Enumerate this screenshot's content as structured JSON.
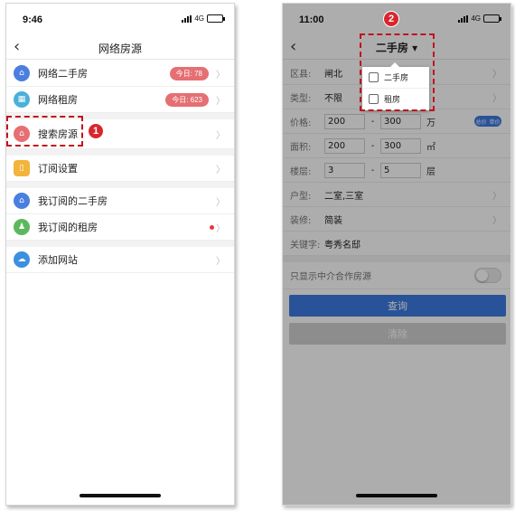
{
  "left": {
    "status": {
      "time": "9:46",
      "network": "4G"
    },
    "nav": {
      "back": "‹",
      "title": "网络房源"
    },
    "items": [
      {
        "label": "网络二手房",
        "badge": "今日: 78",
        "color": "#4a7fe0",
        "icon": "home-icon"
      },
      {
        "label": "网络租房",
        "badge": "今日: 623",
        "color": "#4ab0d8",
        "icon": "rent-icon"
      },
      {
        "label": "搜索房源",
        "color": "#e56f73",
        "icon": "search-house-icon"
      },
      {
        "label": "订阅设置",
        "color": "#f2b43a",
        "icon": "subscribe-icon"
      },
      {
        "label": "我订阅的二手房",
        "color": "#4a7fe0",
        "icon": "house-icon"
      },
      {
        "label": "我订阅的租房",
        "color": "#5cb85c",
        "icon": "user-icon"
      },
      {
        "label": "添加网站",
        "color": "#3d8fe0",
        "icon": "cloud-icon"
      }
    ],
    "callout": "1"
  },
  "right": {
    "status": {
      "time": "11:00",
      "network": "4G"
    },
    "nav": {
      "back": "‹",
      "title": "二手房 ▾"
    },
    "dropdown": [
      "二手房",
      "租房"
    ],
    "callout": "2",
    "form": {
      "district": {
        "label": "区县:",
        "value": "闸北"
      },
      "type": {
        "label": "类型:",
        "value": "不限"
      },
      "price": {
        "label": "价格:",
        "min": "200",
        "max": "300",
        "unit": "万",
        "toggle_a": "总价",
        "toggle_b": "单价"
      },
      "area": {
        "label": "面积:",
        "min": "200",
        "max": "300",
        "unit": "㎡"
      },
      "floor": {
        "label": "楼层:",
        "min": "3",
        "max": "5",
        "unit": "层"
      },
      "layout": {
        "label": "户型:",
        "value": "二室,三室"
      },
      "decoration": {
        "label": "装修:",
        "value": "简装"
      },
      "keyword": {
        "label": "关键字:",
        "value": "粤秀名邸"
      },
      "agency_only": {
        "label": "只显示中介合作房源"
      }
    },
    "buttons": {
      "query": "查询",
      "clear": "清除"
    }
  }
}
